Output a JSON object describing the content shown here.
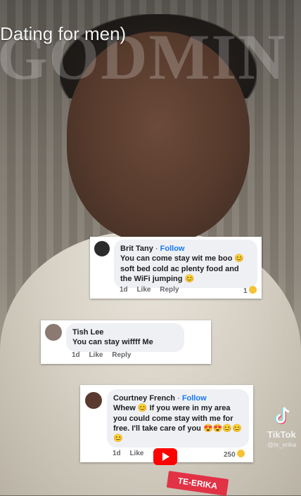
{
  "video": {
    "title": "Dating for men)",
    "watermark": "GODMIN"
  },
  "comments": [
    {
      "author": "Brit Tany",
      "follow": "Follow",
      "text": "You can come stay wit me boo 😊 soft bed cold ac plenty food and the WiFi jumping 😊",
      "time": "1d",
      "like": "Like",
      "reply": "Reply",
      "reaction_count": "1"
    },
    {
      "author": "Tish Lee",
      "follow": "",
      "text": "You can stay wiffff Me",
      "time": "1d",
      "like": "Like",
      "reply": "Reply",
      "reaction_count": ""
    },
    {
      "author": "Courtney French",
      "follow": "Follow",
      "text": "Whew 😊 If you were in my area you could come stay with me for free. I'll take care of you 😍😍😊😊😊",
      "time": "1d",
      "like": "Like",
      "reply": "",
      "reaction_count": "250"
    }
  ],
  "tiktok": {
    "label": "TikTok",
    "handle": "@te_erika"
  },
  "badge": "TE-ERIKA",
  "icons": [
    "youtube-play-icon",
    "tiktok-logo-icon"
  ],
  "colors": {
    "follow": "#1877f2",
    "youtube": "#ff0000",
    "badge": "#e13246"
  }
}
